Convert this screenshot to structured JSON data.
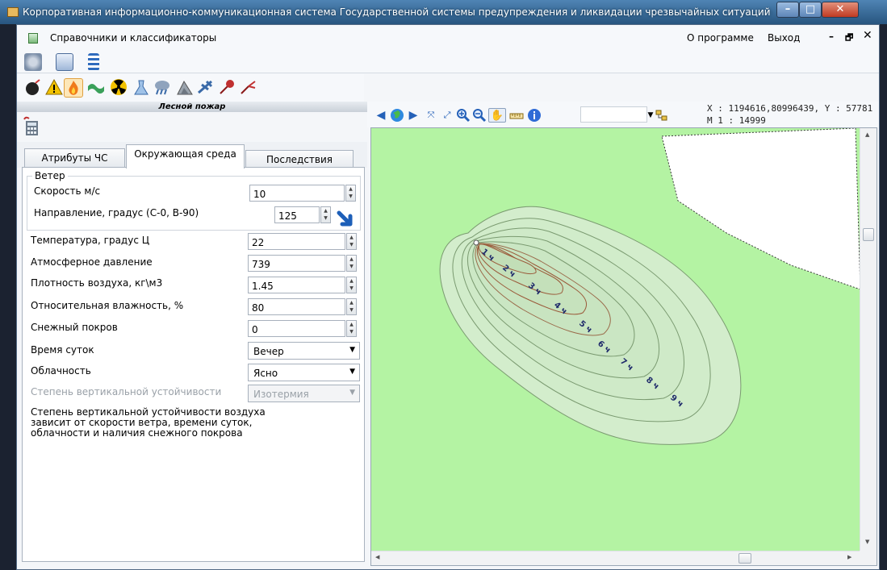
{
  "window": {
    "title": "Корпоративная информационно-коммуникационная система Государственной системы предупреждения и ликвидации чрезвычайных ситуаций - [Расчё...",
    "btn_min": "–",
    "btn_max": "□",
    "btn_close": "✕"
  },
  "menu": {
    "references": "Справочники и классификаторы",
    "about": "О программе",
    "exit": "Выход",
    "mdi_min": "–",
    "mdi_restore": "🗗",
    "mdi_close": "✕"
  },
  "panel_header": "Лесной пожар",
  "tabs": [
    {
      "label": "Атрибуты ЧС"
    },
    {
      "label": "Окружающая среда"
    },
    {
      "label": "Последствия"
    }
  ],
  "wind": {
    "group_title": "Ветер",
    "speed_label": "Скорость м/с",
    "speed_value": "10",
    "direction_label": "Направление, градус (С-0, В-90)",
    "direction_value": "125"
  },
  "fields": {
    "temperature_label": "Температура, градус Ц",
    "temperature_value": "22",
    "pressure_label": "Атмосферное давление",
    "pressure_value": "739",
    "density_label": "Плотность воздуха, кг\\м3",
    "density_value": "1.45",
    "humidity_label": "Относительная влажность, %",
    "humidity_value": "80",
    "snow_label": "Снежный покров",
    "snow_value": "0",
    "daytime_label": "Время суток",
    "daytime_value": "Вечер",
    "cloud_label": "Облачность",
    "cloud_value": "Ясно",
    "stability_label": "Степень вертикальной устойчивости",
    "stability_value": "Изотермия",
    "note": "Степень вертикальной устойчивости воздуха зависит от скорости ветра, времени суток, облачности и наличия снежного покрова"
  },
  "map": {
    "coords": "X : 1194616,80996439, Y : 57781",
    "scale": "М 1 : 14999",
    "contour_labels": [
      "1 ч",
      "2 ч",
      "3 ч",
      "4 ч",
      "5 ч",
      "6 ч",
      "7 ч",
      "8 ч",
      "9 ч"
    ],
    "colors": {
      "land": "#b4f3a3",
      "zone": "#d3edcc",
      "contour": "#7a9a70",
      "inner_contour": "#9a5a3a",
      "label": "#1f2a6b"
    }
  },
  "icons": {
    "hazards": [
      "bomb-icon",
      "warning-icon",
      "fire-icon",
      "flood-icon",
      "radiation-icon",
      "chemical-icon",
      "storm-icon",
      "landslide-icon",
      "aircraft-icon",
      "pipeline-icon",
      "pipe-leak-icon"
    ],
    "map_tools": [
      "back-arrow-icon",
      "globe-icon",
      "forward-arrow-icon",
      "zoom-extent-icon",
      "zoom-full-icon",
      "zoom-in-icon",
      "zoom-out-icon",
      "pan-hand-icon",
      "measure-icon",
      "info-icon"
    ]
  }
}
